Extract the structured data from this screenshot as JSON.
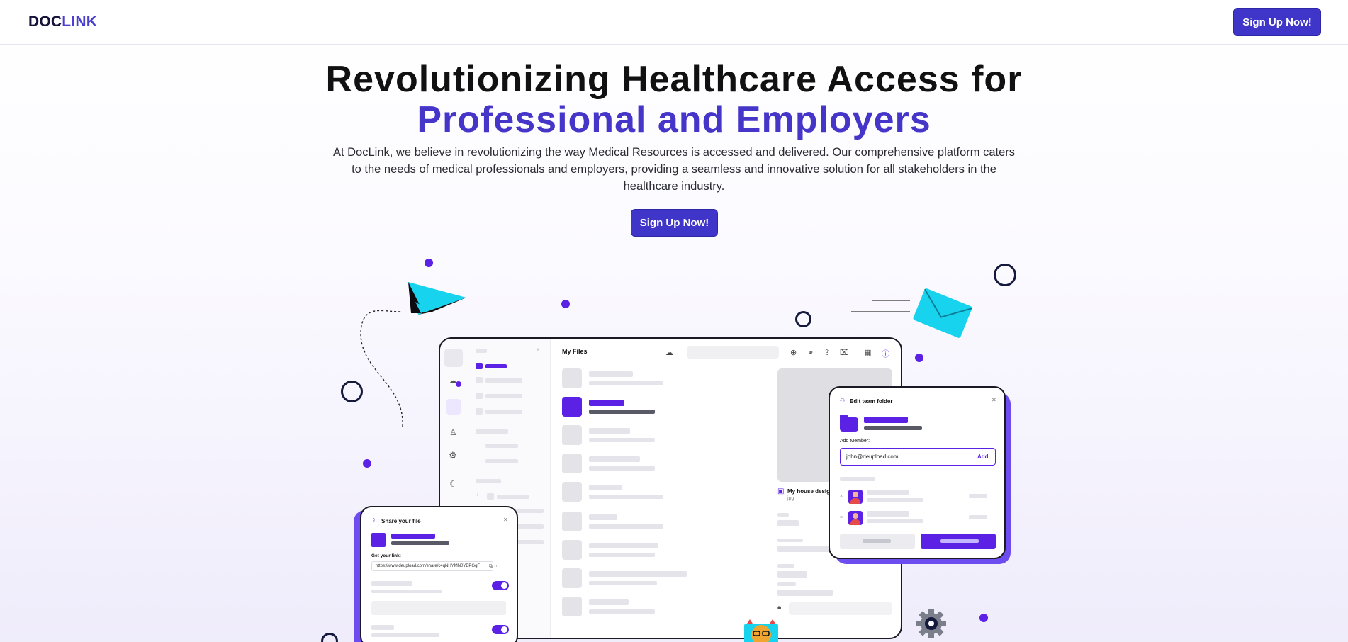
{
  "nav": {
    "brand_part1": "DOC",
    "brand_part2": "LINK",
    "signup_label": "Sign Up Now!"
  },
  "hero": {
    "title_line1": "Revolutionizing Healthcare Access for",
    "title_line2": "Professional and Employers",
    "description": "At DocLink, we believe in revolutionizing the way Medical Resources is accessed and delivered. Our comprehensive platform caters to the needs of medical professionals and employers, providing a seamless and innovative solution for all stakeholders in the healthcare industry.",
    "cta_label": "Sign Up Now!"
  },
  "illustration": {
    "files_panel": {
      "title": "My Files",
      "preview_name": "My house design",
      "preview_ext": "jpg"
    },
    "team_folder_card": {
      "title": "Edit team folder",
      "add_member_label": "Add Member:",
      "member_email": "john@deupload.com",
      "add_button": "Add"
    },
    "share_card": {
      "title": "Share your file",
      "get_link_label": "Get your link:",
      "link_url": "https://www.deupload.com/share/c4qNHYMN0YBPGqF"
    }
  },
  "colors": {
    "brand_dark": "#15133a",
    "brand_accent": "#4a3fd0",
    "button": "#3f36c9",
    "illustration_purple": "#5b22e6",
    "illustration_cyan": "#17d3ee"
  }
}
